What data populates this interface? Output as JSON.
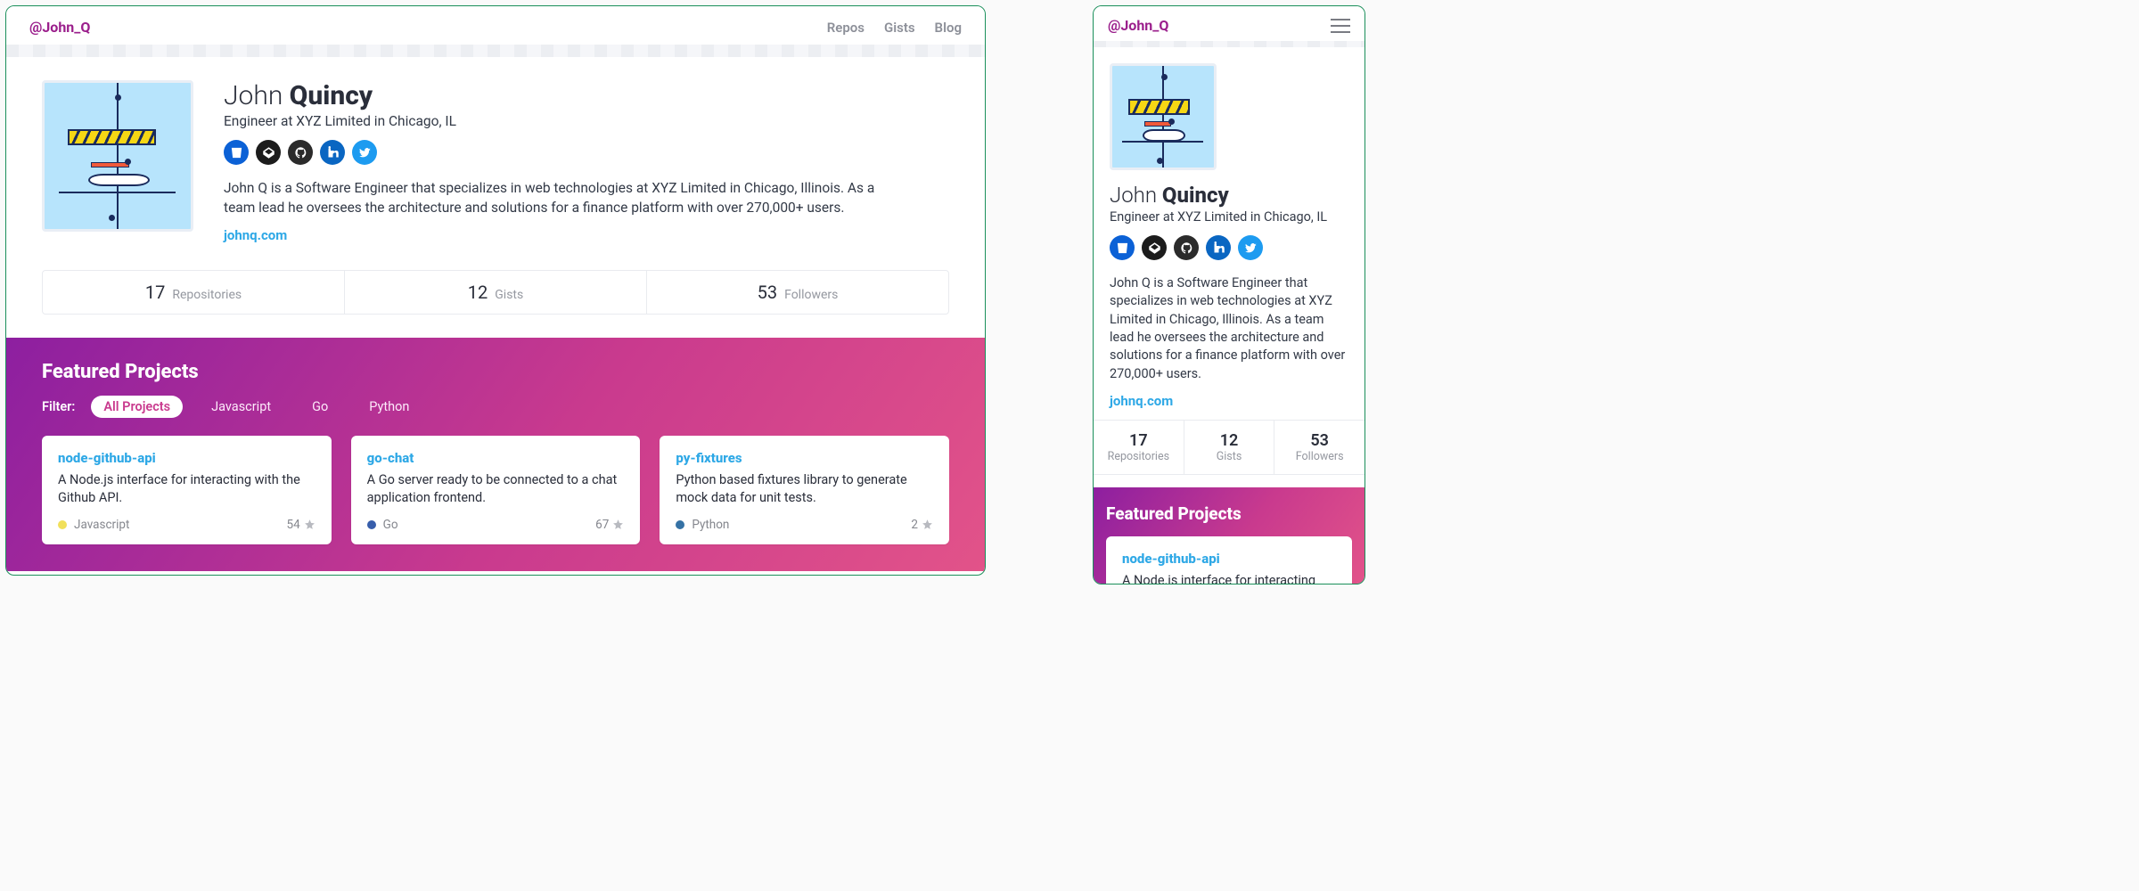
{
  "handle": "@John_Q",
  "nav": {
    "repos": "Repos",
    "gists": "Gists",
    "blog": "Blog"
  },
  "profile": {
    "first_name": "John",
    "last_name": "Quincy",
    "subtitle": "Engineer at XYZ Limited in Chicago, IL",
    "bio": "John Q is a Software Engineer that specializes in web technologies at XYZ Limited in Chicago, Illinois. As a team lead he oversees the architecture and solutions for a finance platform with over 270,000+ users.",
    "site": "johnq.com"
  },
  "socials": [
    {
      "name": "bitbucket",
      "color_class": "c-bb"
    },
    {
      "name": "codepen",
      "color_class": "c-cp"
    },
    {
      "name": "github",
      "color_class": "c-gh"
    },
    {
      "name": "linkedin",
      "color_class": "c-li"
    },
    {
      "name": "twitter",
      "color_class": "c-tw"
    }
  ],
  "stats": {
    "repos": {
      "value": "17",
      "label": "Repositories"
    },
    "gists": {
      "value": "12",
      "label": "Gists"
    },
    "followers": {
      "value": "53",
      "label": "Followers"
    }
  },
  "featured": {
    "title": "Featured Projects",
    "filter_label": "Filter:",
    "filters": [
      {
        "label": "All Projects",
        "active": true
      },
      {
        "label": "Javascript"
      },
      {
        "label": "Go"
      },
      {
        "label": "Python"
      }
    ],
    "projects": [
      {
        "title": "node-github-api",
        "description": "A Node.js interface for interacting with the Github API.",
        "language": "Javascript",
        "lang_color": "#f1e05a",
        "stars": "54"
      },
      {
        "title": "go-chat",
        "description": "A Go server ready to be connected to a chat application frontend.",
        "language": "Go",
        "lang_color": "#375eab",
        "stars": "67"
      },
      {
        "title": "py-fixtures",
        "description": "Python based fixtures library to generate mock data for unit tests.",
        "language": "Python",
        "lang_color": "#3572A5",
        "stars": "2"
      }
    ],
    "mobile_visible_project": {
      "title": "node-github-api",
      "description": "A Node.js interface for interacting with the"
    }
  }
}
